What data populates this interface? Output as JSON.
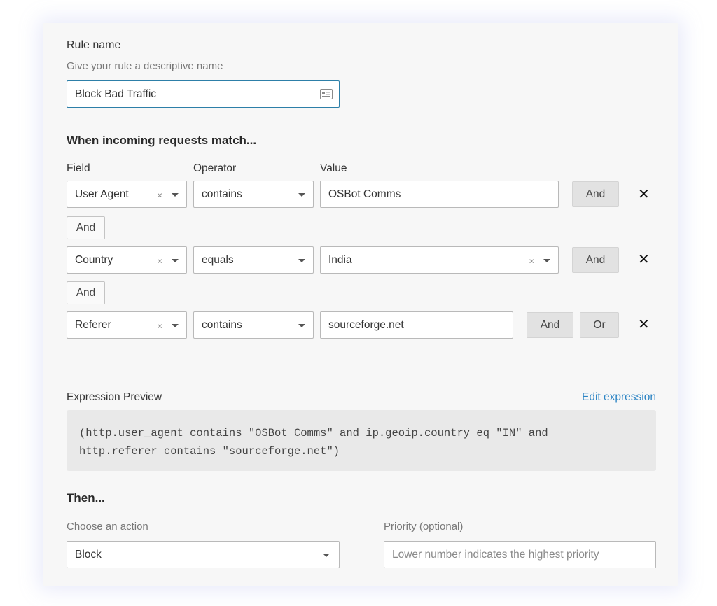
{
  "rule_name": {
    "label": "Rule name",
    "hint": "Give your rule a descriptive name",
    "value": "Block Bad Traffic",
    "icon": "contact-card-icon"
  },
  "match_heading": "When incoming requests match...",
  "columns": {
    "field": "Field",
    "operator": "Operator",
    "value": "Value"
  },
  "conditions": [
    {
      "field": "User Agent",
      "operator": "contains",
      "value": "OSBot Comms",
      "buttons": [
        "And"
      ]
    },
    {
      "field": "Country",
      "operator": "equals",
      "value": "India",
      "buttons": [
        "And"
      ]
    },
    {
      "field": "Referer",
      "operator": "contains",
      "value": "sourceforge.net",
      "buttons": [
        "And",
        "Or"
      ]
    }
  ],
  "connectors": [
    "And",
    "And"
  ],
  "clear_glyph": "×",
  "remove_glyph": "✕",
  "expression": {
    "label": "Expression Preview",
    "edit_link": "Edit expression",
    "text": "(http.user_agent contains \"OSBot Comms\" and ip.geoip.country eq \"IN\" and\nhttp.referer contains \"sourceforge.net\")"
  },
  "then": {
    "heading": "Then...",
    "action_label": "Choose an action",
    "action_value": "Block",
    "priority_label": "Priority (optional)",
    "priority_placeholder": "Lower number indicates the highest priority"
  },
  "colors": {
    "accent": "#2c84c4",
    "focus_border": "#2d7fa8"
  }
}
